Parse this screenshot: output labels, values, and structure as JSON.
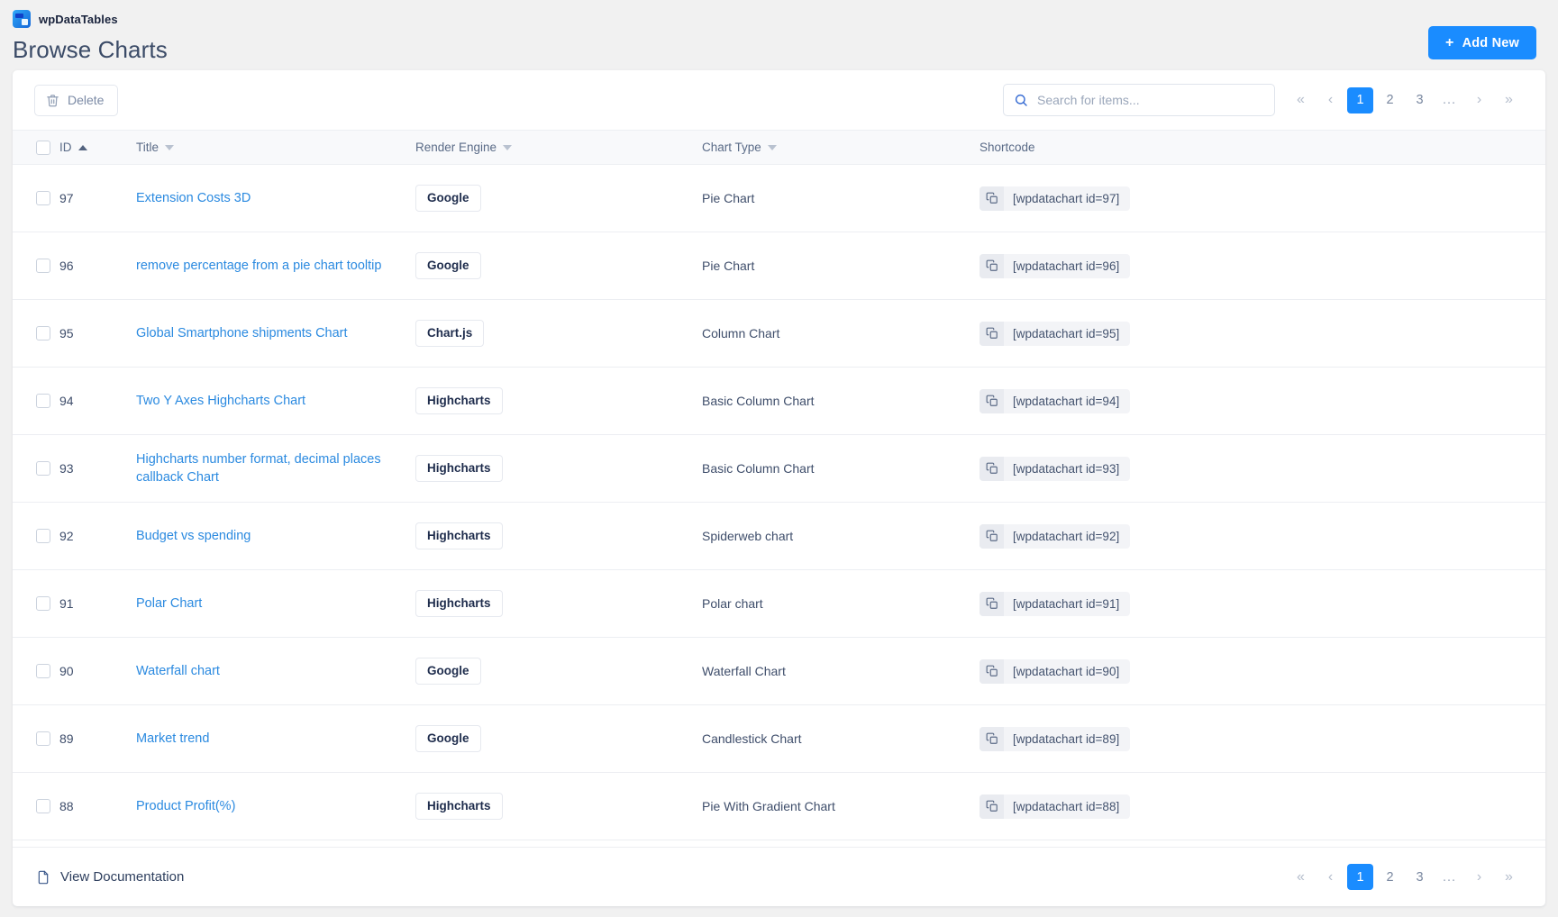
{
  "app": {
    "brand_name": "wpDataTables",
    "page_title": "Browse Charts",
    "logo_icon": "wpdatatables-logo-icon"
  },
  "header": {
    "add_new_label": "Add New",
    "add_new_plus": "+",
    "accent_color": "#1a8cff"
  },
  "toolbar": {
    "delete_label": "Delete",
    "delete_icon": "trash-icon",
    "search_placeholder": "Search for items...",
    "search_value": "",
    "search_icon": "search-icon"
  },
  "pagination": {
    "first_label": "«",
    "prev_label": "‹",
    "pages": [
      "1",
      "2",
      "3"
    ],
    "ellipsis": "...",
    "next_label": "›",
    "last_label": "»",
    "active_page": "1",
    "active_color": "#1a8cff"
  },
  "table": {
    "columns": [
      {
        "key": "checkbox",
        "label": "",
        "sort": "none"
      },
      {
        "key": "id",
        "label": "ID",
        "sort": "asc"
      },
      {
        "key": "title",
        "label": "Title",
        "sort": "desc"
      },
      {
        "key": "engine",
        "label": "Render Engine",
        "sort": "desc"
      },
      {
        "key": "type",
        "label": "Chart Type",
        "sort": "desc"
      },
      {
        "key": "shortcode",
        "label": "Shortcode",
        "sort": "none"
      }
    ],
    "rows": [
      {
        "id": "97",
        "title": "Extension Costs 3D",
        "engine": "Google",
        "type": "Pie Chart",
        "shortcode": "[wpdatachart id=97]"
      },
      {
        "id": "96",
        "title": "remove percentage from a pie chart tooltip",
        "engine": "Google",
        "type": "Pie Chart",
        "shortcode": "[wpdatachart id=96]"
      },
      {
        "id": "95",
        "title": "Global Smartphone shipments Chart",
        "engine": "Chart.js",
        "type": "Column Chart",
        "shortcode": "[wpdatachart id=95]"
      },
      {
        "id": "94",
        "title": "Two Y Axes Highcharts Chart",
        "engine": "Highcharts",
        "type": "Basic Column Chart",
        "shortcode": "[wpdatachart id=94]"
      },
      {
        "id": "93",
        "title": "Highcharts number format, decimal places callback Chart",
        "engine": "Highcharts",
        "type": "Basic Column Chart",
        "shortcode": "[wpdatachart id=93]"
      },
      {
        "id": "92",
        "title": "Budget vs spending",
        "engine": "Highcharts",
        "type": "Spiderweb chart",
        "shortcode": "[wpdatachart id=92]"
      },
      {
        "id": "91",
        "title": "Polar Chart",
        "engine": "Highcharts",
        "type": "Polar chart",
        "shortcode": "[wpdatachart id=91]"
      },
      {
        "id": "90",
        "title": "Waterfall chart",
        "engine": "Google",
        "type": "Waterfall Chart",
        "shortcode": "[wpdatachart id=90]"
      },
      {
        "id": "89",
        "title": "Market trend",
        "engine": "Google",
        "type": "Candlestick Chart",
        "shortcode": "[wpdatachart id=89]"
      },
      {
        "id": "88",
        "title": "Product Profit(%)",
        "engine": "Highcharts",
        "type": "Pie With Gradient Chart",
        "shortcode": "[wpdatachart id=88]"
      }
    ],
    "copy_icon": "copy-icon"
  },
  "footer": {
    "doc_label": "View Documentation",
    "doc_icon": "document-icon"
  }
}
